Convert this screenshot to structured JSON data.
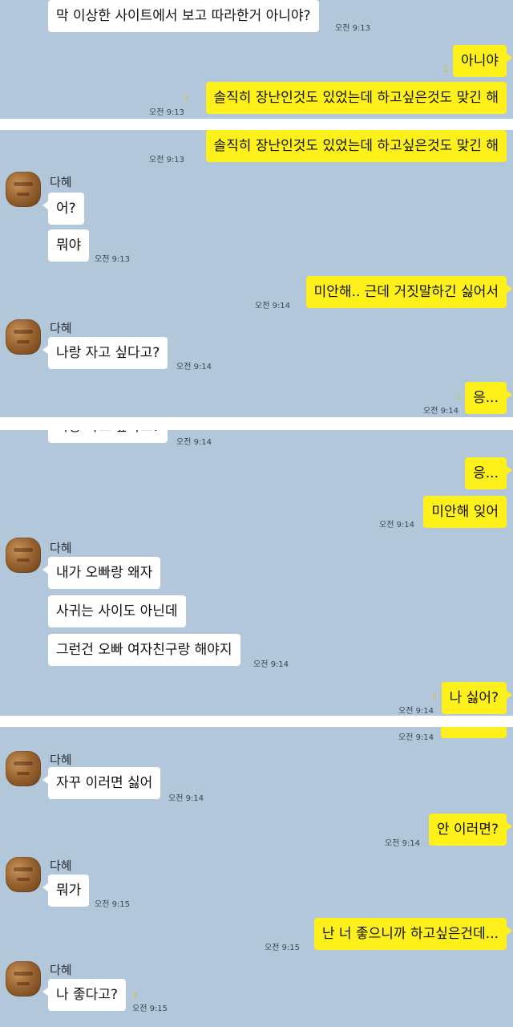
{
  "contact": {
    "name": "다혜"
  },
  "labels": {
    "unread": "1"
  },
  "panel1": {
    "m1": {
      "text": "막 이상한 사이트에서 보고 따라한거 아니야?",
      "time": "오전 9:13"
    },
    "m2": {
      "text": "아니야"
    },
    "m3": {
      "text": "솔직히 장난인것도 있었는데 하고싶은것도 맞긴 해",
      "time": "오전 9:13"
    }
  },
  "panel2": {
    "m1": {
      "text": "솔직히 장난인것도 있었는데 하고싶은것도 맞긴 해",
      "time": "오전 9:13"
    },
    "m2": {
      "text": "어?"
    },
    "m3": {
      "text": "뭐야",
      "time": "오전 9:13"
    },
    "m4": {
      "text": "미안해.. 근데 거짓말하긴 싫어서",
      "time": "오전 9:14"
    },
    "m5": {
      "text": "나랑 자고 싶다고?",
      "time": "오전 9:14"
    },
    "m6": {
      "text": "응...",
      "time": "오전 9:14"
    }
  },
  "panel3": {
    "m0": {
      "text": "나랑 자고 싶다고?",
      "time": "오전 9:14"
    },
    "m1": {
      "text": "응..."
    },
    "m2": {
      "text": "미안해 잊어",
      "time": "오전 9:14"
    },
    "m3": {
      "text": "내가 오빠랑 왜자"
    },
    "m4": {
      "text": "사귀는 사이도 아닌데"
    },
    "m5": {
      "text": "그런건 오빠 여자친구랑 해야지",
      "time": "오전 9:14"
    },
    "m6": {
      "text": "나 싫어?",
      "time": "오전 9:14"
    }
  },
  "panel4": {
    "m0": {
      "time": "오전 9:14"
    },
    "m1": {
      "text": "자꾸 이러면 싫어",
      "time": "오전 9:14"
    },
    "m2": {
      "text": "안 이러면?",
      "time": "오전 9:14"
    },
    "m3": {
      "text": "뭐가",
      "time": "오전 9:15"
    },
    "m4": {
      "text": "난 너 좋으니까 하고싶은건데...",
      "time": "오전 9:15"
    },
    "m5": {
      "text": "나 좋다고?",
      "time": "오전 9:15"
    }
  }
}
